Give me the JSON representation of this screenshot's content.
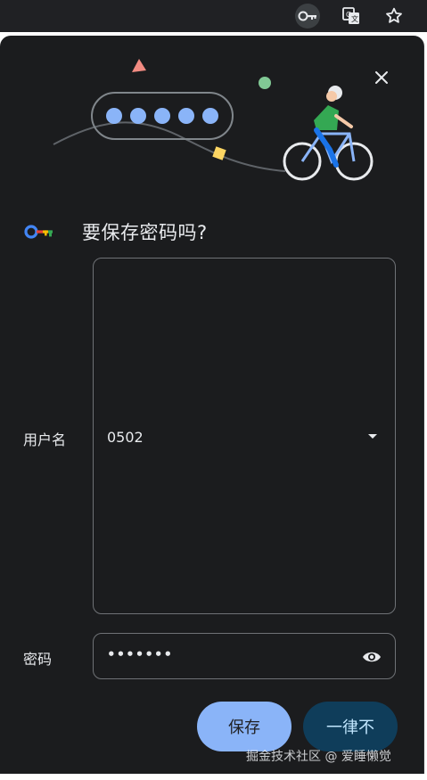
{
  "toolbar": {
    "icons": [
      "key-icon",
      "translate-icon",
      "star-icon"
    ]
  },
  "dialog": {
    "title": "要保存密码吗?",
    "username_label": "用户名",
    "username_value": "0502",
    "password_label": "密码",
    "password_value": "•••••••",
    "save_label": "保存",
    "never_label": "一律不"
  },
  "colors": {
    "dialog_bg": "#1b1c1e",
    "save_bg": "#8ab4f8",
    "never_bg": "#0f3d5a",
    "field_border": "#6f7276"
  },
  "watermark": "掘金技术社区 @ 爱睡懒觉"
}
